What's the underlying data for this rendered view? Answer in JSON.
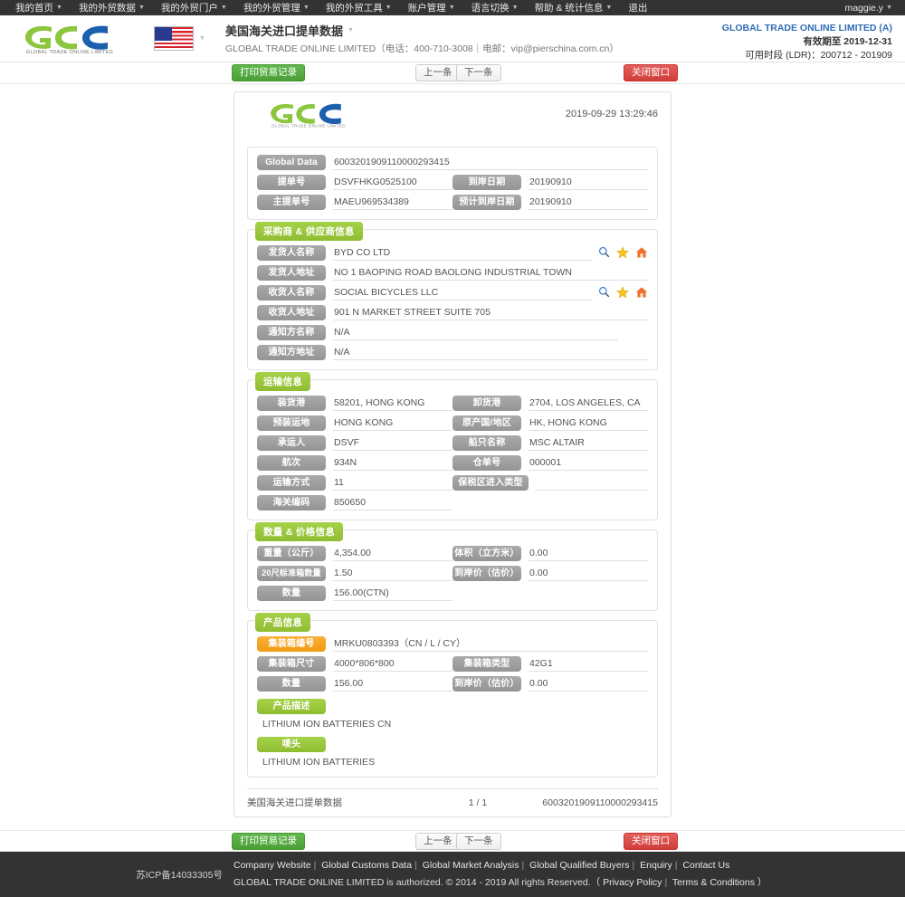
{
  "topnav": {
    "items": [
      {
        "label": "我的首页",
        "caret": true
      },
      {
        "label": "我的外贸数据",
        "caret": true
      },
      {
        "label": "我的外贸门户",
        "caret": true
      },
      {
        "label": "我的外贸管理",
        "caret": true
      },
      {
        "label": "我的外贸工具",
        "caret": true
      },
      {
        "label": "账户管理",
        "caret": true
      },
      {
        "label": "语言切换",
        "caret": true
      },
      {
        "label": "帮助 & 统计信息",
        "caret": true
      },
      {
        "label": "退出",
        "caret": false
      }
    ],
    "user": "maggie.y"
  },
  "header": {
    "logo_text": "GLOBAL TRADE ONLINE LIMITED",
    "flag_icon": "us-flag-icon",
    "title_cn": "美国海关进口提单数据",
    "title_en": "GLOBAL TRADE ONLINE LIMITED（电话：400-710-3008｜电邮：vip@pierschina.com.cn）",
    "account_company": "GLOBAL TRADE ONLINE LIMITED (A)",
    "account_valid": "有效期至 2019-12-31",
    "account_ldr": "可用时段 (LDR)：200712 - 201909"
  },
  "toolbar": {
    "print_label": "打印贸易记录",
    "prev_label": "上一条",
    "next_label": "下一条",
    "close_label": "关闭窗口"
  },
  "document": {
    "date": "2019-09-29 13:29:46",
    "top_fields": [
      {
        "label": "Global Data",
        "value": "6003201909110000293415"
      },
      {
        "label": "提单号",
        "value": "DSVFHKG0525100"
      },
      {
        "label": "到岸日期",
        "value": "20190910"
      },
      {
        "label": "主提单号",
        "value": "MAEU969534389"
      },
      {
        "label": "预计到岸日期",
        "value": "20190910"
      }
    ],
    "sections": {
      "parties": {
        "title": "采购商 & 供应商信息",
        "rows": [
          {
            "label": "发货人名称",
            "value": "BYD CO LTD",
            "icons": true
          },
          {
            "label": "发货人地址",
            "value": "NO 1 BAOPING ROAD BAOLONG INDUSTRIAL TOWN",
            "icons": false
          },
          {
            "label": "收货人名称",
            "value": "SOCIAL BICYCLES LLC",
            "icons": true
          },
          {
            "label": "收货人地址",
            "value": "901 N MARKET STREET SUITE 705",
            "icons": false
          },
          {
            "label": "通知方名称",
            "value": "N/A",
            "icons": false
          },
          {
            "label": "通知方地址",
            "value": "N/A",
            "icons": false
          }
        ],
        "icon_names": [
          "search-icon",
          "star-icon",
          "home-icon"
        ]
      },
      "shipping": {
        "title": "运输信息",
        "pairs": [
          [
            {
              "label": "装货港",
              "value": "58201, HONG KONG"
            },
            {
              "label": "卸货港",
              "value": "2704, LOS ANGELES, CA"
            }
          ],
          [
            {
              "label": "预装运地",
              "value": "HONG KONG"
            },
            {
              "label": "原产国/地区",
              "value": "HK, HONG KONG"
            }
          ],
          [
            {
              "label": "承运人",
              "value": "DSVF"
            },
            {
              "label": "船只名称",
              "value": "MSC ALTAIR"
            }
          ],
          [
            {
              "label": "航次",
              "value": "934N"
            },
            {
              "label": "仓单号",
              "value": "000001"
            }
          ],
          [
            {
              "label": "运输方式",
              "value": "11"
            },
            {
              "label": "保税区进入类型",
              "value": ""
            }
          ],
          [
            {
              "label": "海关编码",
              "value": "850650"
            },
            {
              "label": "",
              "value": ""
            }
          ]
        ]
      },
      "quantity": {
        "title": "数量 & 价格信息",
        "pairs": [
          [
            {
              "label": "重量（公斤）",
              "value": "4,354.00"
            },
            {
              "label": "体积（立方米）",
              "value": "0.00"
            }
          ],
          [
            {
              "label": "20尺标准箱数量",
              "value": "1.50"
            },
            {
              "label": "到岸价（估价）",
              "value": "0.00"
            }
          ],
          [
            {
              "label": "数量",
              "value": "156.00(CTN)"
            },
            {
              "label": "",
              "value": ""
            }
          ]
        ]
      },
      "product": {
        "title": "产品信息",
        "container_no_label": "集装箱编号",
        "container_no_value": "MRKU0803393（CN / L / CY）",
        "pairs": [
          [
            {
              "label": "集装箱尺寸",
              "value": "4000*806*800"
            },
            {
              "label": "集装箱类型",
              "value": "42G1"
            }
          ],
          [
            {
              "label": "数量",
              "value": "156.00"
            },
            {
              "label": "到岸价（估价）",
              "value": "0.00"
            }
          ]
        ],
        "desc_label": "产品描述",
        "desc_value": "LITHIUM ION BATTERIES CN",
        "mark_label": "唛头",
        "mark_value": "LITHIUM ION BATTERIES"
      }
    },
    "footer": {
      "source": "美国海关进口提单数据",
      "page": "1 / 1",
      "ref": "6003201909110000293415"
    }
  },
  "footer": {
    "icp": "苏ICP备14033305号",
    "links": [
      "Company Website",
      "Global Customs Data",
      "Global Market Analysis",
      "Global Qualified Buyers",
      "Enquiry",
      "Contact Us"
    ],
    "copyright_prefix": "GLOBAL TRADE ONLINE LIMITED is authorized. © 2014 - 2019 All rights Reserved.（",
    "policy": "Privacy Policy",
    "terms": "Terms & Conditions",
    "copyright_suffix": "）"
  },
  "colors": {
    "nav_bg": "#333333",
    "green": "#9ac93c",
    "orange": "#f5a623",
    "gray_label": "#9e9e9e",
    "brand_blue": "#2f6cb5",
    "btn_green": "#4fa83d",
    "btn_red": "#d9534f"
  }
}
